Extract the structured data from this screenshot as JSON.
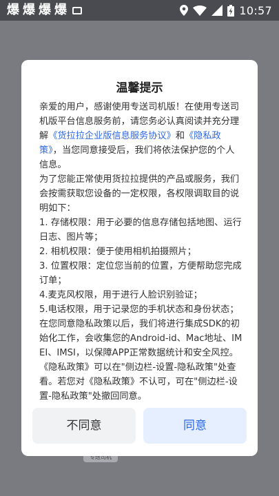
{
  "status_bar": {
    "time": "10:57",
    "notification_glyphs": [
      "爆",
      "爆",
      "爆",
      "爆"
    ]
  },
  "background": {
    "tag_label": "专送司机"
  },
  "dialog": {
    "title": "温馨提示",
    "intro_prefix": "亲爱的用户，感谢使用专送司机版！在使用专送司机版平台信息服务前，请您务必认真阅读并充分理解",
    "link_service": "《货拉拉企业版信息服务协议》",
    "and": "和",
    "link_privacy": "《隐私政策》",
    "intro_suffix": "，当您同意接受后，我们将依法保护您的个人信息。",
    "para2": "为了您能正常使用货拉拉提供的产品或服务，我们会按需获取您设备的一定权限，各权限调取目的说明如下：",
    "perm1": " 1. 存储权限：用于必要的信息存储包括地图、运行日志、图片等；",
    "perm2": "2. 相机权限：便于使用相机拍摄照片；",
    "perm3": "3. 位置权限：定位您当前的位置，方便帮助您完成订单；",
    "perm4": "4.麦克风权限，用于进行人脸识别验证；",
    "perm5": "5.电话权限，用于记录您的手机状态和身份状态；",
    "para3": "在您同意隐私政策以后，我们将进行集成SDK的初始化工作，会收集您的Android-id、Mac地址、IMEI、IMSI，以保障APP正常数据统计和安全风控。",
    "para4": "《隐私政策》可以在\"侧边栏-设置-隐私政策\"处查看。若您对《隐私政策》不认可，可在\"侧边栏-设置-隐私政策\"处撤回同意。",
    "disagree_label": "不同意",
    "agree_label": "同意"
  },
  "colors": {
    "link": "#2c67e6",
    "agree_bg": "#e6efff",
    "disagree_bg": "#f1f2f4",
    "scrim": "#7a7b80"
  }
}
